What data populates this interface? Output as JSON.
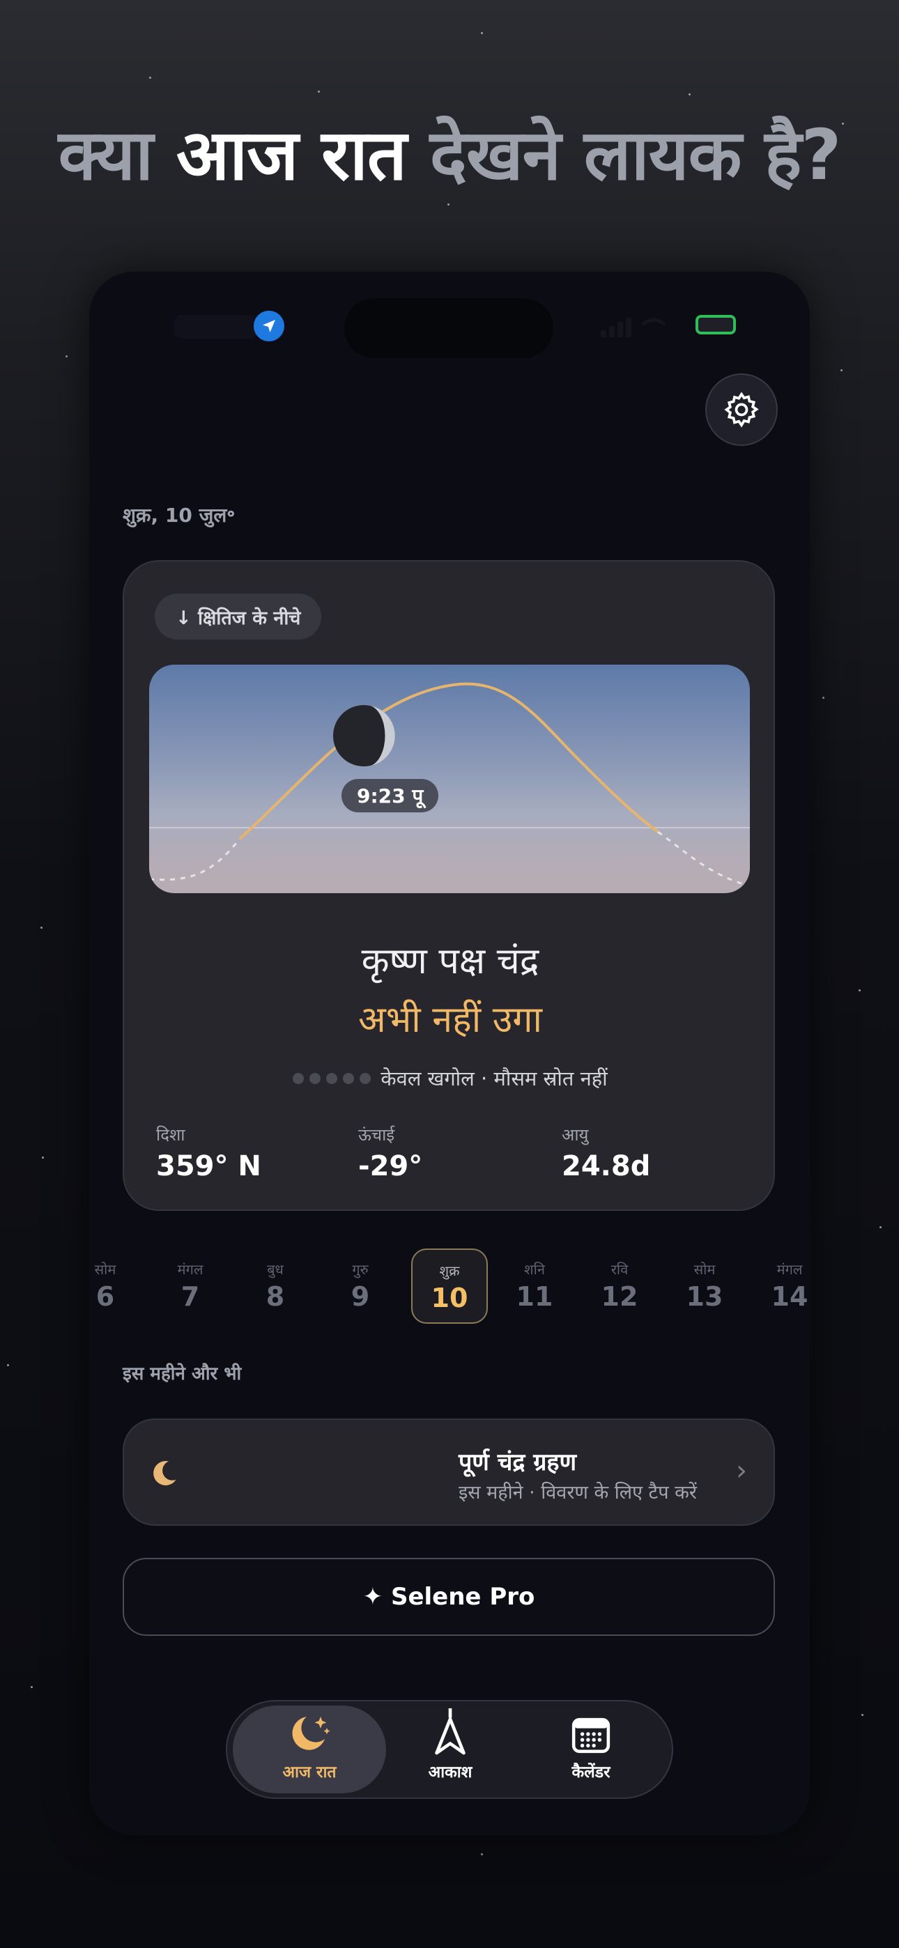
{
  "headline": {
    "part1": "क्या",
    "part2": "आज रात",
    "part3": "देखने लायक है?"
  },
  "colors": {
    "accent": "#f0b867",
    "background": "#0b0c14",
    "card": "#26262c",
    "location_blue": "#1f7ae0",
    "battery_green": "#2fbf58"
  },
  "status_bar": {
    "location_icon": "location-arrow-icon",
    "battery_icon": "battery-icon"
  },
  "settings": {
    "icon": "gear-icon"
  },
  "date_label": "शुक्र, 10 जुल॰",
  "moon_card": {
    "horizon_badge": "↓ क्षितिज के नीचे",
    "moon_time": "9:23 पू",
    "phase_name": "कृष्ण पक्ष चंद्र",
    "status": "अभी नहीं उगा",
    "source_note": "केवल खगोल · मौसम स्रोत नहीं",
    "stats": [
      {
        "label": "दिशा",
        "value": "359° N"
      },
      {
        "label": "ऊंचाई",
        "value": "-29°"
      },
      {
        "label": "आयु",
        "value": "24.8d"
      }
    ]
  },
  "days": [
    {
      "name": "सोम",
      "date": "6"
    },
    {
      "name": "मंगल",
      "date": "7"
    },
    {
      "name": "बुध",
      "date": "8"
    },
    {
      "name": "गुरु",
      "date": "9"
    },
    {
      "name": "शुक्र",
      "date": "10",
      "selected": true
    },
    {
      "name": "शनि",
      "date": "11"
    },
    {
      "name": "रवि",
      "date": "12"
    },
    {
      "name": "सोम",
      "date": "13"
    },
    {
      "name": "मंगल",
      "date": "14"
    }
  ],
  "month_section": {
    "label": "इस महीने और भी",
    "event_title": "पूर्ण चंद्र ग्रहण",
    "event_subtitle": "इस महीने · विवरण के लिए टैप करें",
    "event_icon": "crescent-moon-icon"
  },
  "pro_button": "✦ Selene Pro",
  "tabs": [
    {
      "label": "आज रात",
      "icon": "moon-stars-icon",
      "active": true
    },
    {
      "label": "आकाश",
      "icon": "compass-arrow-icon"
    },
    {
      "label": "कैलेंडर",
      "icon": "calendar-icon"
    }
  ]
}
